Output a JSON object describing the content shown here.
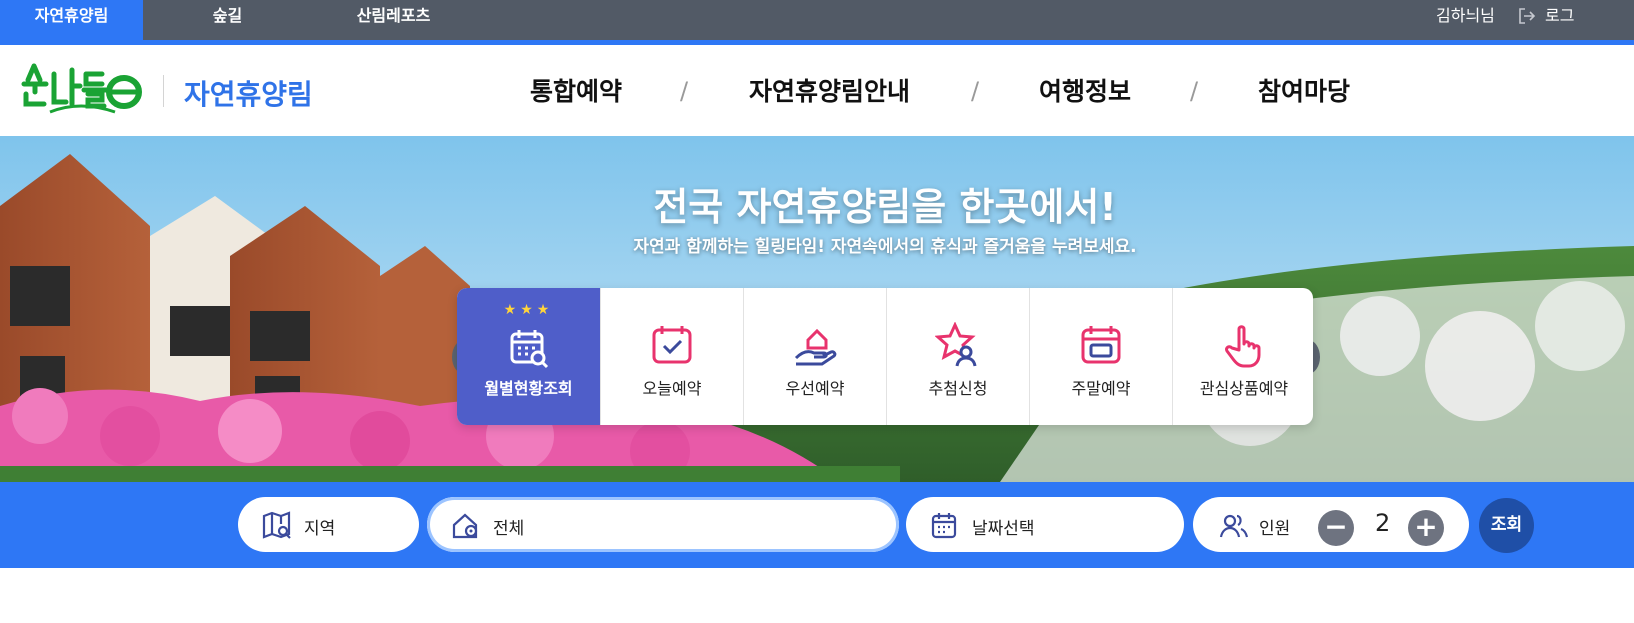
{
  "topbar": {
    "tabs": [
      {
        "label": "자연휴양림",
        "active": true
      },
      {
        "label": "숲길",
        "active": false
      },
      {
        "label": "산림레포츠",
        "active": false
      }
    ],
    "user_name": "김하늬님",
    "logout_label": "로그"
  },
  "header": {
    "logo_text": "숲나들e",
    "site_title": "자연휴양림",
    "gnb": [
      "통합예약",
      "자연휴양림안내",
      "여행정보",
      "참여마당"
    ],
    "gnb_separator": "/"
  },
  "hero": {
    "title": "전국 자연휴양림을 한곳에서!",
    "subtitle": "자연과 함께하는 힐링타임! 자연속에서의 휴식과 즐거움을 누려보세요."
  },
  "quick_menu": {
    "stars": "★★★",
    "items": [
      {
        "label": "월별현황조회",
        "icon": "calendar-search-icon",
        "active": true
      },
      {
        "label": "오늘예약",
        "icon": "calendar-check-icon",
        "active": false
      },
      {
        "label": "우선예약",
        "icon": "hand-house-icon",
        "active": false
      },
      {
        "label": "추첨신청",
        "icon": "star-person-icon",
        "active": false
      },
      {
        "label": "주말예약",
        "icon": "calendar-grid-icon",
        "active": false
      },
      {
        "label": "관심상품예약",
        "icon": "pointing-hand-icon",
        "active": false
      }
    ]
  },
  "search": {
    "region_label": "지역",
    "facility_value": "전체",
    "date_placeholder": "날짜선택",
    "people_label": "인원",
    "people_count": "2",
    "minus": "−",
    "plus": "+",
    "submit_label": "조회"
  },
  "colors": {
    "primary": "#2e77f5",
    "topbar": "#525a66",
    "quick_active": "#4f5ec9",
    "icon_pink": "#e8336d",
    "icon_navy": "#3b4a9c",
    "logo_green": "#1aa334"
  }
}
